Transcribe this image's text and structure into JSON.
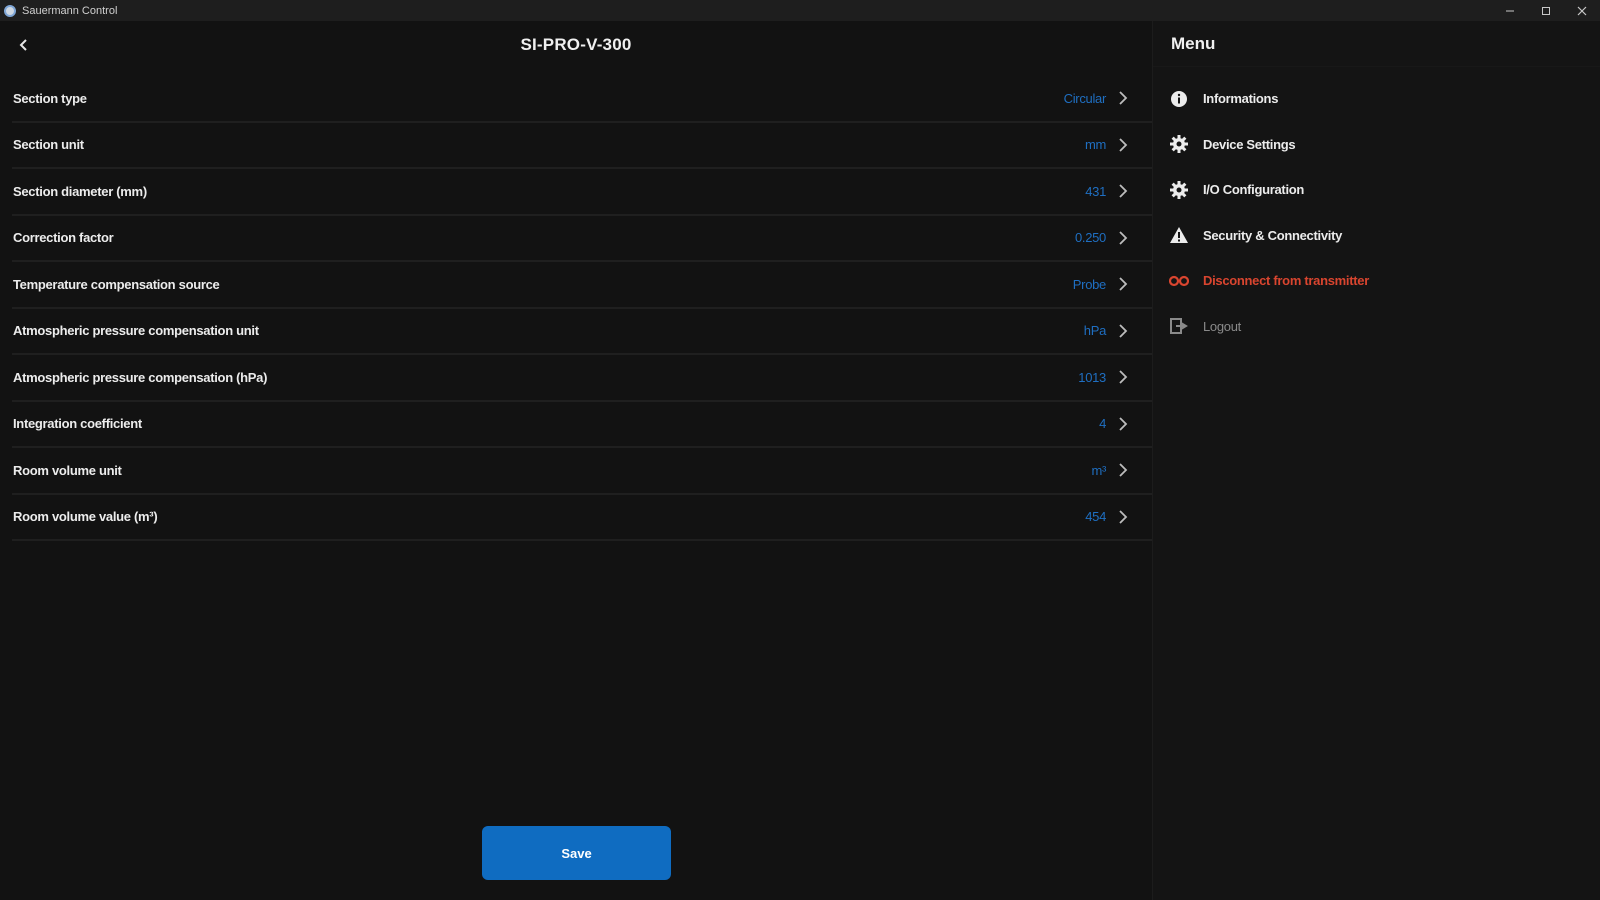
{
  "window": {
    "title": "Sauermann Control",
    "controls": [
      "minimize-icon",
      "maximize-icon",
      "close-icon"
    ]
  },
  "header": {
    "title": "SI-PRO-V-300"
  },
  "settings": [
    {
      "label": "Section type",
      "value": "Circular"
    },
    {
      "label": "Section unit",
      "value": "mm"
    },
    {
      "label": "Section diameter (mm)",
      "value": "431"
    },
    {
      "label": "Correction factor",
      "value": "0.250"
    },
    {
      "label": "Temperature compensation source",
      "value": "Probe"
    },
    {
      "label": "Atmospheric pressure compensation unit",
      "value": "hPa"
    },
    {
      "label": "Atmospheric pressure compensation (hPa)",
      "value": "1013"
    },
    {
      "label": "Integration coefficient",
      "value": "4"
    },
    {
      "label": "Room volume unit",
      "value": "m³"
    },
    {
      "label": "Room volume value (m³)",
      "value": "454"
    }
  ],
  "save_label": "Save",
  "sidebar": {
    "title": "Menu",
    "items": [
      {
        "label": "Informations",
        "icon": "info-icon"
      },
      {
        "label": "Device Settings",
        "icon": "gear-icon"
      },
      {
        "label": "I/O Configuration",
        "icon": "gear-icon"
      },
      {
        "label": "Security & Connectivity",
        "icon": "warning-icon"
      },
      {
        "label": "Disconnect from transmitter",
        "icon": "disconnect-icon"
      },
      {
        "label": "Logout",
        "icon": "logout-icon"
      }
    ]
  },
  "colors": {
    "background": "#121212",
    "accent": "#0f6cc1",
    "value_text": "#1f6fc2",
    "danger": "#d9452f"
  }
}
